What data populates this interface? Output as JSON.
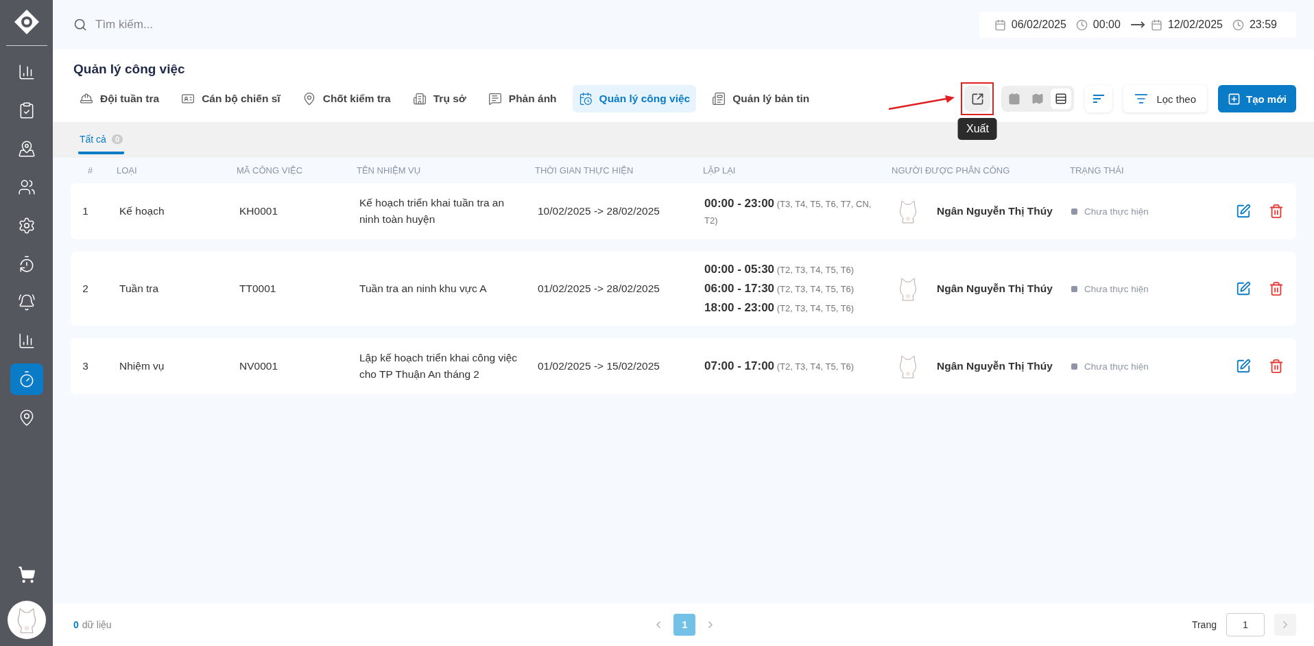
{
  "sidebar": {
    "items": [
      {
        "selected": false
      },
      {
        "selected": false
      },
      {
        "selected": false
      },
      {
        "selected": false
      },
      {
        "selected": false
      },
      {
        "selected": false
      },
      {
        "selected": false
      },
      {
        "selected": false
      },
      {
        "selected": true
      },
      {
        "selected": false
      }
    ]
  },
  "search": {
    "placeholder": "Tìm kiếm..."
  },
  "date_range": {
    "start_date": "06/02/2025",
    "start_time": "00:00",
    "end_date": "12/02/2025",
    "end_time": "23:59"
  },
  "page_title": "Quản lý công việc",
  "nav_tabs": [
    {
      "label": "Đội tuần tra",
      "selected": false
    },
    {
      "label": "Cán bộ chiến sĩ",
      "selected": false
    },
    {
      "label": "Chốt kiểm tra",
      "selected": false
    },
    {
      "label": "Trụ sở",
      "selected": false
    },
    {
      "label": "Phản ánh",
      "selected": false
    },
    {
      "label": "Quản lý công việc",
      "selected": true
    },
    {
      "label": "Quản lý bản tin",
      "selected": false
    }
  ],
  "toolbar": {
    "export": {
      "tooltip": "Xuất",
      "highlighted": true
    },
    "views": [
      {
        "selected": false
      },
      {
        "selected": false
      },
      {
        "selected": true
      }
    ],
    "filter_label": "Lọc theo",
    "create_label": "Tạo mới"
  },
  "sub_tabs": [
    {
      "label": "Tất cả",
      "count": "0",
      "selected": true
    }
  ],
  "columns": [
    "#",
    "LOẠI",
    "MÃ CÔNG VIỆC",
    "TÊN NHIỆM VỤ",
    "THỜI GIAN THỰC HIỆN",
    "LẶP LẠI",
    "NGƯỜI ĐƯỢC PHÂN CÔNG",
    "TRẠNG THÁI"
  ],
  "rows": [
    {
      "index": "1",
      "type": "Kế hoạch",
      "code": "KH0001",
      "name": "Kế hoạch triển khai tuần tra an ninh toàn huyện",
      "period": "10/02/2025 -> 28/02/2025",
      "schedules": [
        "**00:00 - 23:00** (T3, T4, T5, T6, T7, CN, T2)"
      ],
      "assignee": "Ngân Nguyễn Thị Thúy",
      "status": "Chưa thực hiện"
    },
    {
      "index": "2",
      "type": "Tuần tra",
      "code": "TT0001",
      "name": "Tuần tra an ninh khu vực A",
      "period": "01/02/2025 -> 28/02/2025",
      "schedules": [
        "**00:00 - 05:30** (T2, T3, T4, T5, T6)",
        "**06:00 - 17:30** (T2, T3, T4, T5, T6)",
        "**18:00 - 23:00** (T2, T3, T4, T5, T6)"
      ],
      "assignee": "Ngân Nguyễn Thị Thúy",
      "status": "Chưa thực hiện"
    },
    {
      "index": "3",
      "type": "Nhiệm vụ",
      "code": "NV0001",
      "name": "Lập kế hoạch triển khai công việc cho TP Thuận An tháng 2",
      "period": "01/02/2025 -> 15/02/2025",
      "schedules": [
        "**07:00 - 17:00** (T2, T3, T4, T5, T6)"
      ],
      "assignee": "Ngân Nguyễn Thị Thúy",
      "status": "Chưa thực hiện"
    }
  ],
  "footer": {
    "count": "0",
    "count_label": "dữ liệu",
    "pages": [
      {
        "label": "1",
        "selected": true
      }
    ],
    "page_label": "Trang",
    "page_input": "1"
  }
}
